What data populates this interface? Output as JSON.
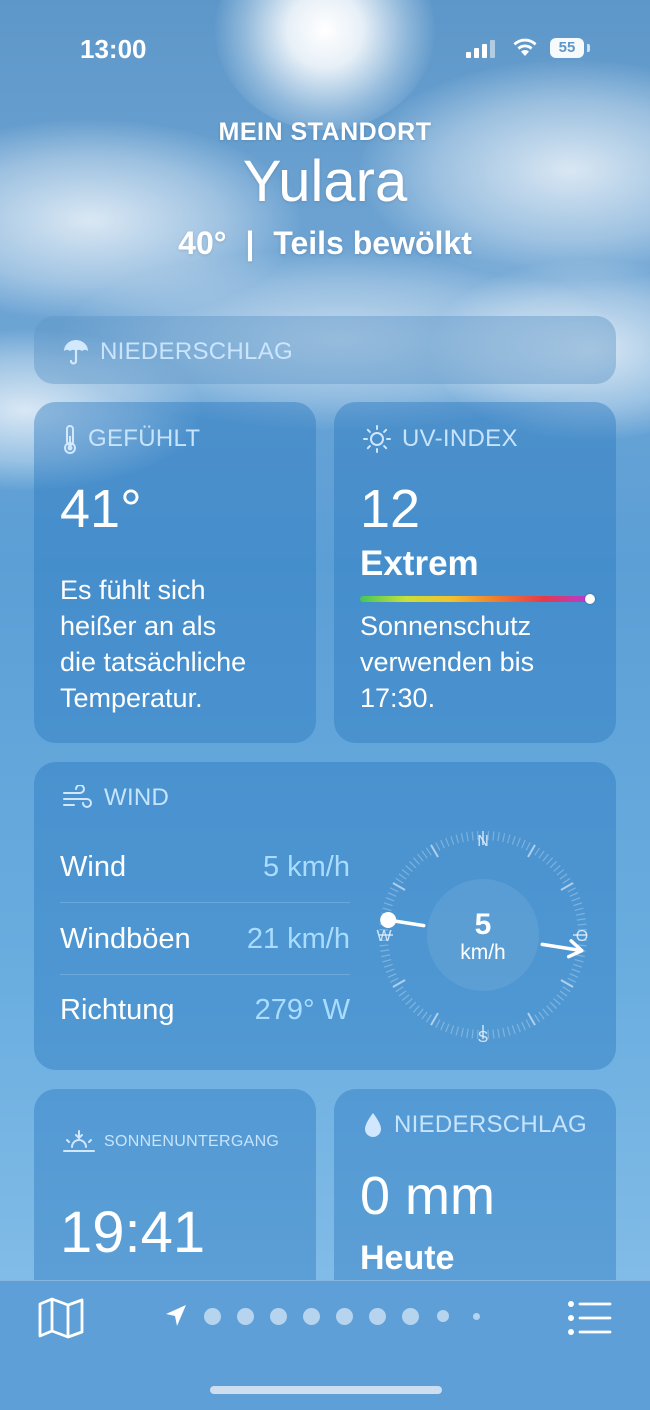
{
  "status_bar": {
    "time": "13:00",
    "battery": "55"
  },
  "header": {
    "location_label": "MEIN STANDORT",
    "city": "Yulara",
    "temperature": "40°",
    "separator": "|",
    "condition": "Teils bewölkt"
  },
  "precip_banner": {
    "title": "NIEDERSCHLAG",
    "icon": "umbrella-icon"
  },
  "feels_like": {
    "title": "GEFÜHLT",
    "icon": "thermometer-icon",
    "value": "41°",
    "description_lines": [
      "Es fühlt sich",
      "heißer an als",
      "die tatsächliche",
      "Temperatur."
    ]
  },
  "uv_index": {
    "title": "UV-INDEX",
    "icon": "sun-icon",
    "value": "12",
    "level": "Extrem",
    "level_fraction": 1.0,
    "description_lines": [
      "Sonnenschutz",
      "verwenden bis",
      "17:30."
    ]
  },
  "wind": {
    "title": "WIND",
    "icon": "wind-icon",
    "rows": [
      {
        "label": "Wind",
        "value": "5 km/h"
      },
      {
        "label": "Windböen",
        "value": "21 km/h"
      },
      {
        "label": "Richtung",
        "value": "279° W"
      }
    ],
    "compass": {
      "north": "N",
      "south": "S",
      "west": "W",
      "east": "O",
      "speed": "5",
      "unit": "km/h",
      "direction_deg": 279
    }
  },
  "sunset": {
    "title": "SONNENUNTERGANG",
    "icon": "sunset-icon",
    "value": "19:41"
  },
  "precipitation": {
    "title": "NIEDERSCHLAG",
    "icon": "drop-icon",
    "value": "0 mm",
    "period": "Heute"
  },
  "tab_bar": {
    "left_icon": "map-icon",
    "right_icon": "list-icon",
    "location_icon": "location-arrow-icon",
    "page_count": 9
  }
}
